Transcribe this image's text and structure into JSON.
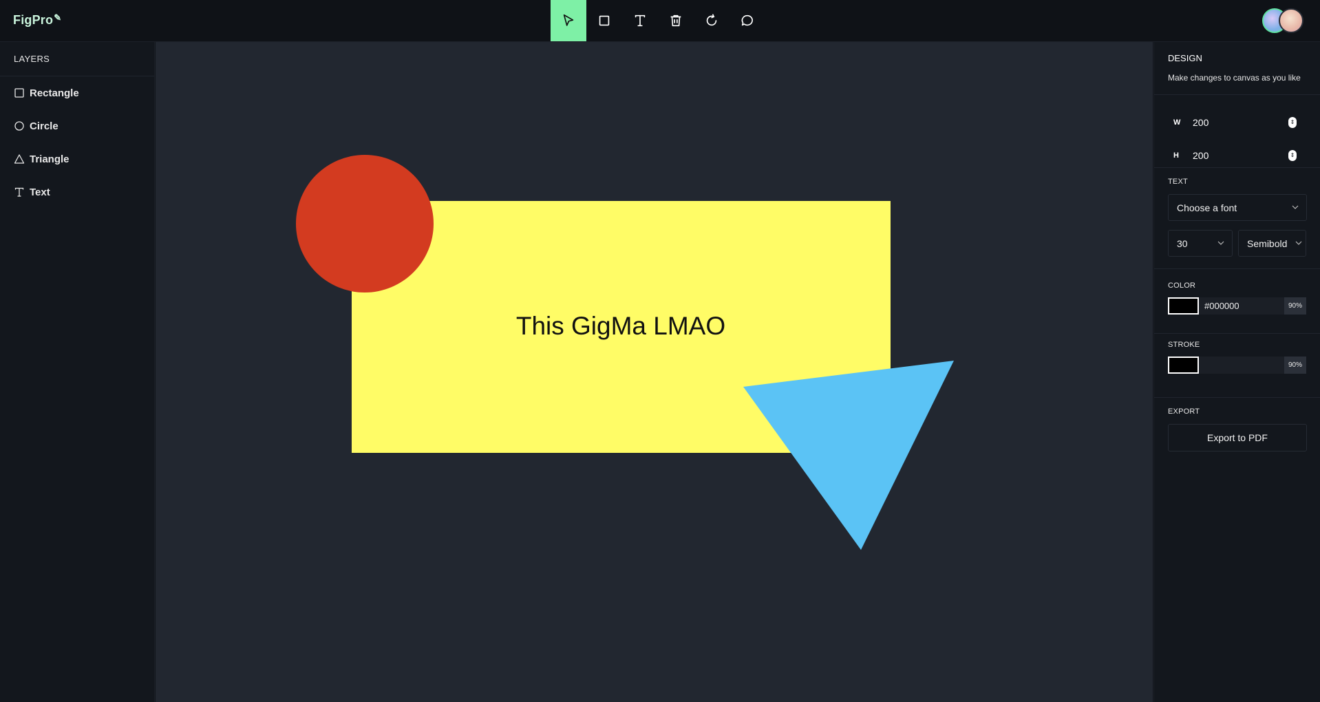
{
  "app": {
    "logo": "FigPro",
    "logo_mark": "✎"
  },
  "toolbar": {
    "tools": [
      {
        "name": "select",
        "active": true
      },
      {
        "name": "rectangle",
        "active": false
      },
      {
        "name": "text",
        "active": false
      },
      {
        "name": "delete",
        "active": false
      },
      {
        "name": "reset",
        "active": false
      },
      {
        "name": "comments",
        "active": false
      }
    ]
  },
  "layers": {
    "title": "LAYERS",
    "items": [
      {
        "label": "Rectangle",
        "icon": "square-icon"
      },
      {
        "label": "Circle",
        "icon": "circle-icon"
      },
      {
        "label": "Triangle",
        "icon": "triangle-icon"
      },
      {
        "label": "Text",
        "icon": "text-icon"
      }
    ]
  },
  "canvas": {
    "rectangle": {
      "color": "#fffc66"
    },
    "circle": {
      "color": "#d33b20"
    },
    "triangle": {
      "color": "#5bc3f5"
    },
    "text": {
      "content": "This GigMa LMAO",
      "color": "#111111"
    }
  },
  "design": {
    "title": "DESIGN",
    "subtitle": "Make changes to canvas as you like",
    "width_label": "W",
    "width_value": "200",
    "height_label": "H",
    "height_value": "200",
    "text_title": "TEXT",
    "font_placeholder": "Choose a font",
    "font_size": "30",
    "font_weight": "Semibold",
    "color_title": "COLOR",
    "color_hex": "#000000",
    "color_opacity": "90%",
    "stroke_title": "STROKE",
    "stroke_opacity": "90%",
    "export_title": "EXPORT",
    "export_label": "Export to PDF"
  },
  "colors": {
    "accent": "#7ef0a6",
    "background": "#222730",
    "panel": "#13171d"
  }
}
